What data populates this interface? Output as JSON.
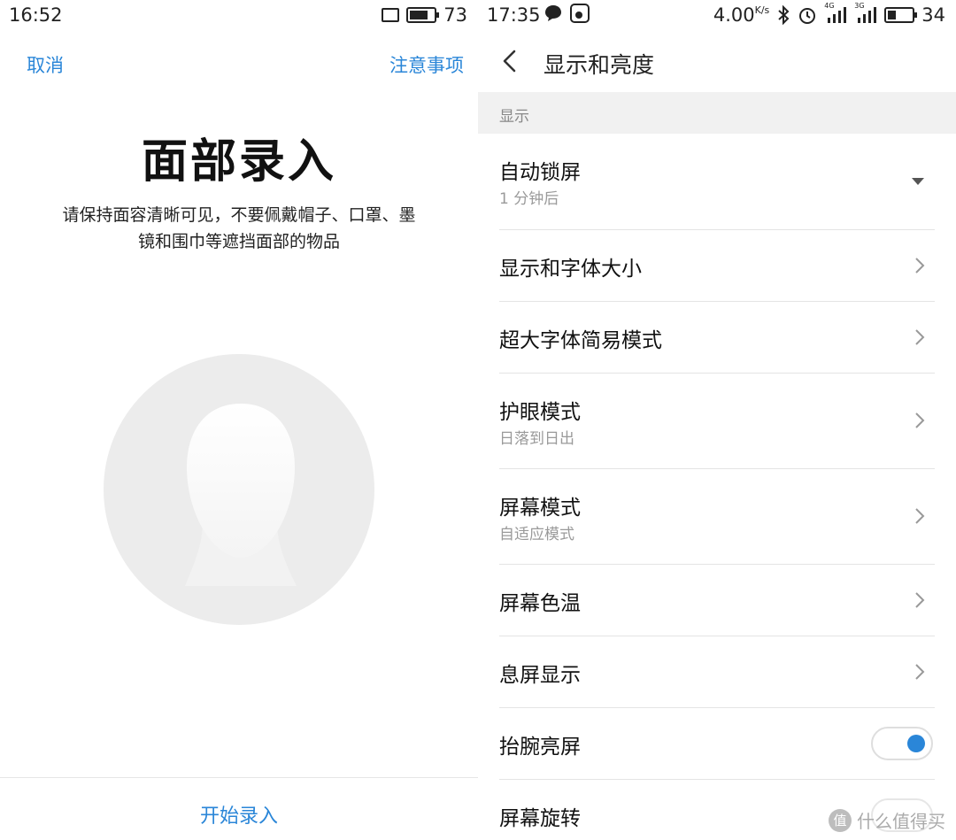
{
  "left": {
    "status": {
      "time": "16:52",
      "battery": "73",
      "battery_level": 0.73
    },
    "cancel": "取消",
    "notice": "注意事项",
    "title": "面部录入",
    "description": "请保持面容清晰可见，不要佩戴帽子、口罩、墨镜和围巾等遮挡面部的物品",
    "start": "开始录入"
  },
  "right": {
    "status": {
      "time": "17:35",
      "speed": "4.00",
      "speed_unit": "K/s",
      "net1": "4G",
      "net2": "3G",
      "battery": "34",
      "battery_level": 0.34
    },
    "title": "显示和亮度",
    "section": "显示",
    "rows": [
      {
        "label": "自动锁屏",
        "sub": "1 分钟后",
        "control": "dropdown"
      },
      {
        "label": "显示和字体大小",
        "sub": "",
        "control": "chevron"
      },
      {
        "label": "超大字体简易模式",
        "sub": "",
        "control": "chevron"
      },
      {
        "label": "护眼模式",
        "sub": "日落到日出",
        "control": "chevron"
      },
      {
        "label": "屏幕模式",
        "sub": "自适应模式",
        "control": "chevron"
      },
      {
        "label": "屏幕色温",
        "sub": "",
        "control": "chevron"
      },
      {
        "label": "息屏显示",
        "sub": "",
        "control": "chevron"
      },
      {
        "label": "抬腕亮屏",
        "sub": "",
        "control": "toggle",
        "on": true
      },
      {
        "label": "屏幕旋转",
        "sub": "",
        "control": "toggle",
        "on": false
      }
    ],
    "watermark": "什么值得买",
    "watermark_icon": "值"
  },
  "colors": {
    "accent": "#2a86d8",
    "placeholder": "#ececec"
  }
}
